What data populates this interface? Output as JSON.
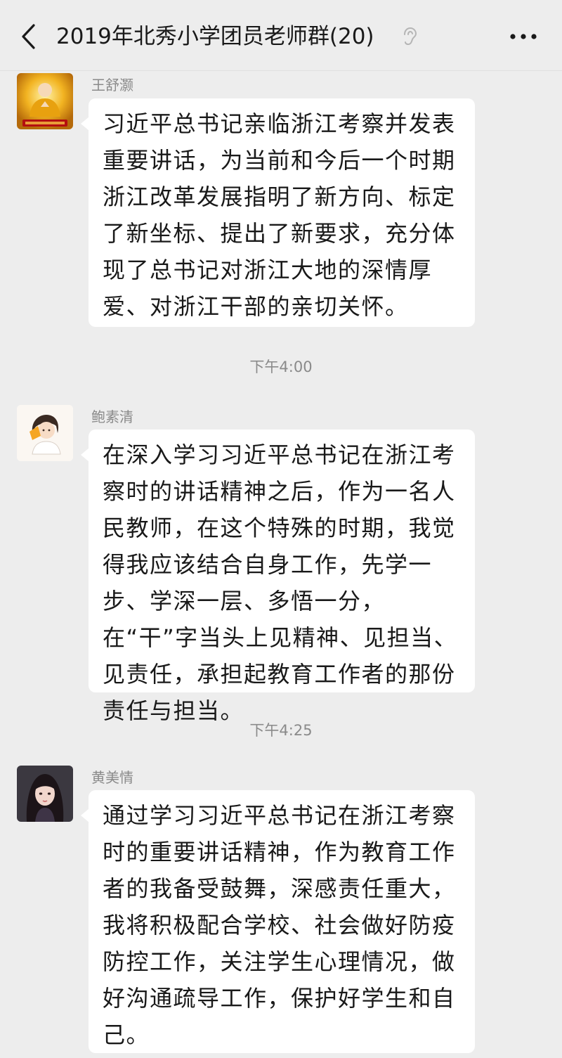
{
  "header": {
    "title": "2019年北秀小学团员老师群(20)",
    "back_icon": "chevron-left-icon",
    "mute_icon": "ear-muted-icon",
    "more_icon": "more-dots-icon"
  },
  "messages": [
    {
      "sender": "王舒灏",
      "avatar_icon": "avatar-gold-buddha-icon",
      "text": "习近平总书记亲临浙江考察并发表重要讲话，为当前和今后一个时期浙江改革发展指明了新方向、标定了新坐标、提出了新要求，充分体现了总书记对浙江大地的深情厚爱、对浙江干部的亲切关怀。"
    },
    {
      "sender": "鲍素清",
      "avatar_icon": "avatar-cartoon-girl-icon",
      "text": "在深入学习习近平总书记在浙江考察时的讲话精神之后，作为一名人民教师，在这个特殊的时期，我觉得我应该结合自身工作，先学一步、学深一层、多悟一分，在“干”字当头上见精神、见担当、见责任，承担起教育工作者的那份责任与担当。"
    },
    {
      "sender": "黄美情",
      "avatar_icon": "avatar-illustrated-woman-icon",
      "text": "通过学习习近平总书记在浙江考察时的重要讲话精神，作为教育工作者的我备受鼓舞，深感责任重大，我将积极配合学校、社会做好防疫防控工作，关注学生心理情况，做好沟通疏导工作，保护好学生和自己。"
    }
  ],
  "timestamps": [
    "下午4:00",
    "下午4:25"
  ],
  "colors": {
    "background": "#ededed",
    "bubble": "#ffffff",
    "text": "#191919",
    "meta_text": "#8a8a8a"
  }
}
